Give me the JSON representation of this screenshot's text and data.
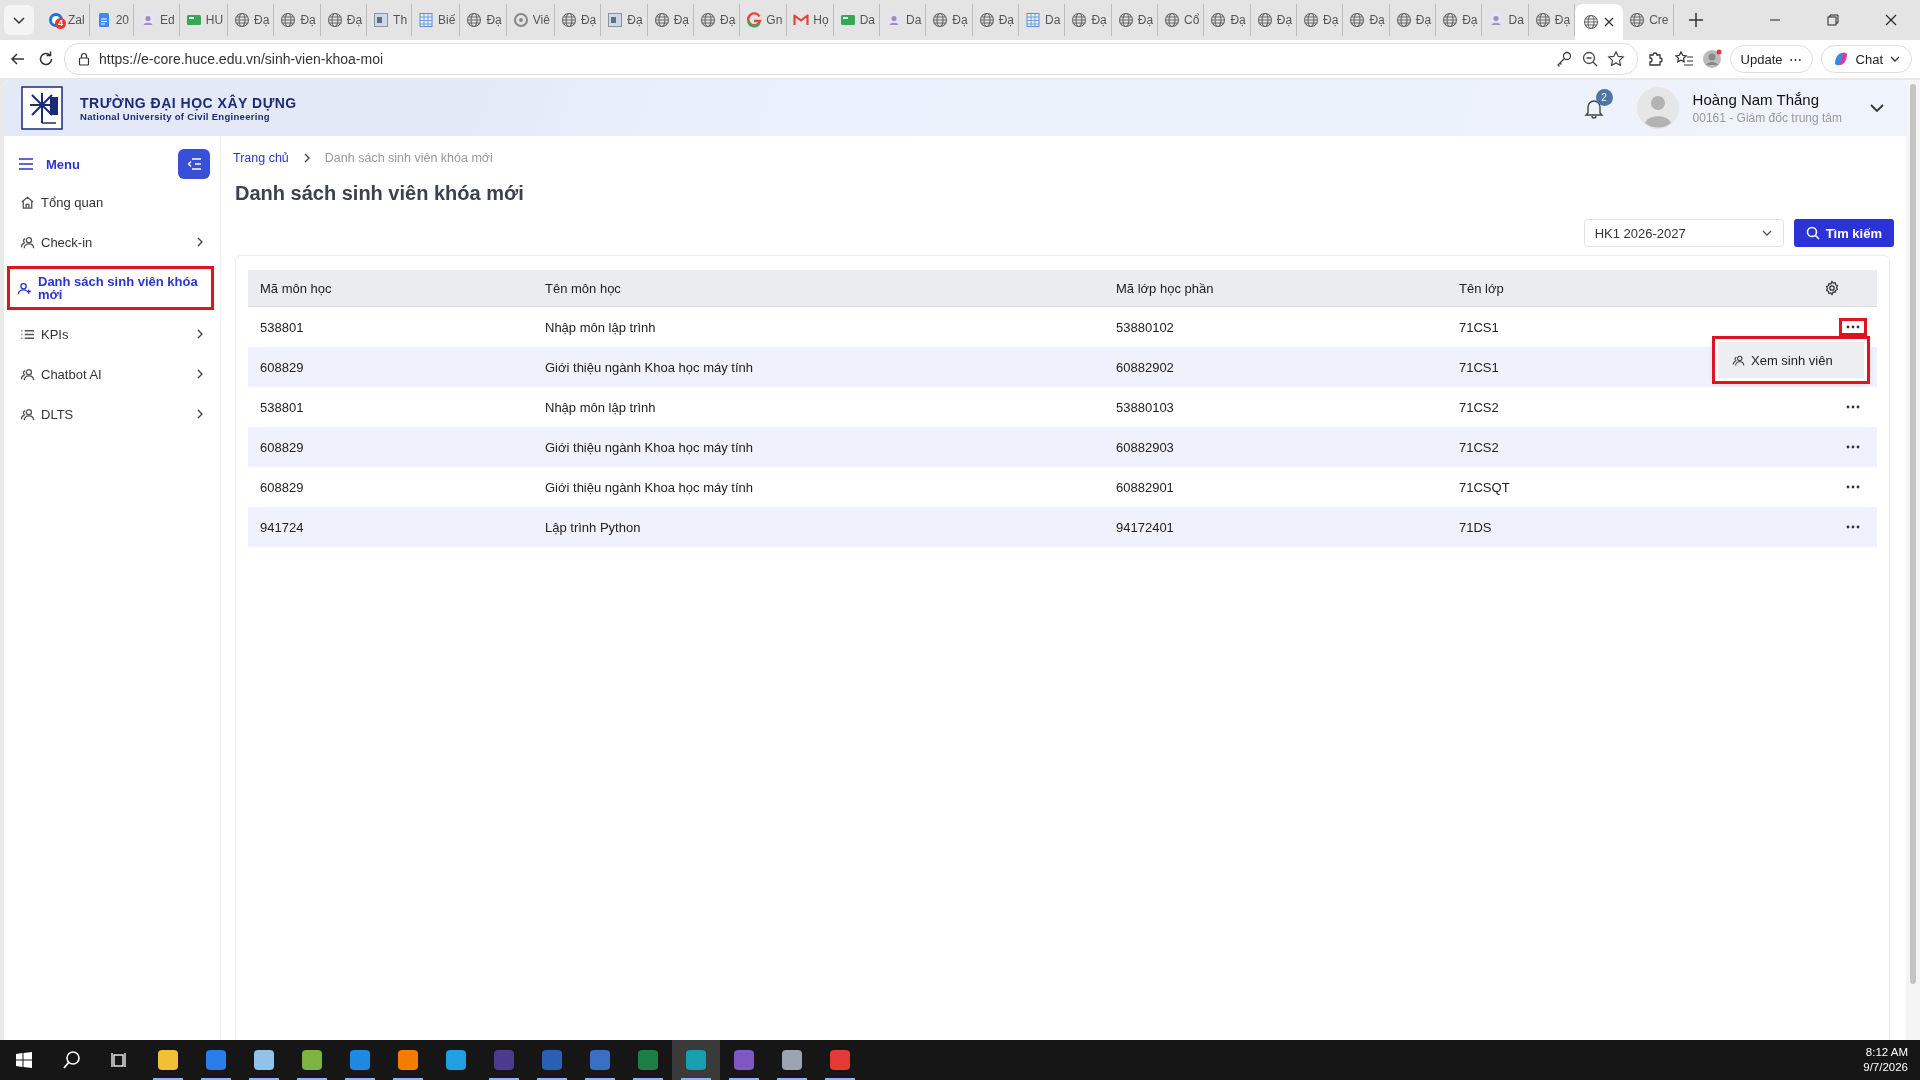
{
  "browser": {
    "tabs": [
      {
        "title": "Zal",
        "kind": "chat",
        "badge": "4",
        "selected": false
      },
      {
        "title": "20",
        "kind": "doc",
        "selected": false
      },
      {
        "title": "Ed",
        "kind": "person",
        "selected": false
      },
      {
        "title": "HU",
        "kind": "sheet",
        "selected": false
      },
      {
        "title": "Đạ",
        "kind": "globe",
        "selected": false
      },
      {
        "title": "Đạ",
        "kind": "globe",
        "selected": false
      },
      {
        "title": "Đạ",
        "kind": "globe",
        "selected": false
      },
      {
        "title": "Th",
        "kind": "image",
        "selected": false
      },
      {
        "title": "Biế",
        "kind": "grid",
        "selected": false
      },
      {
        "title": "Đạ",
        "kind": "globe",
        "selected": false
      },
      {
        "title": "Viê",
        "kind": "ring",
        "selected": false
      },
      {
        "title": "Đạ",
        "kind": "globe",
        "selected": false
      },
      {
        "title": "Đạ",
        "kind": "image",
        "selected": false
      },
      {
        "title": "Đạ",
        "kind": "globe",
        "selected": false
      },
      {
        "title": "Đạ",
        "kind": "globe",
        "selected": false
      },
      {
        "title": "Gn",
        "kind": "google",
        "selected": false
      },
      {
        "title": "Họ",
        "kind": "mail",
        "selected": false
      },
      {
        "title": "Da",
        "kind": "sheet",
        "selected": false
      },
      {
        "title": "Da",
        "kind": "person",
        "selected": false
      },
      {
        "title": "Đạ",
        "kind": "globe",
        "selected": false
      },
      {
        "title": "Đạ",
        "kind": "globe",
        "selected": false
      },
      {
        "title": "Da",
        "kind": "grid",
        "selected": false
      },
      {
        "title": "Đạ",
        "kind": "globe",
        "selected": false
      },
      {
        "title": "Đạ",
        "kind": "globe",
        "selected": false
      },
      {
        "title": "Cổ",
        "kind": "globe",
        "selected": false
      },
      {
        "title": "Đạ",
        "kind": "globe",
        "selected": false
      },
      {
        "title": "Đạ",
        "kind": "globe",
        "selected": false
      },
      {
        "title": "Đạ",
        "kind": "globe",
        "selected": false
      },
      {
        "title": "Đạ",
        "kind": "globe",
        "selected": false
      },
      {
        "title": "Đạ",
        "kind": "globe",
        "selected": false
      },
      {
        "title": "Đạ",
        "kind": "globe",
        "selected": false
      },
      {
        "title": "Da",
        "kind": "person",
        "selected": false
      },
      {
        "title": "Đạ",
        "kind": "globe",
        "selected": false
      },
      {
        "kind": "globe",
        "selected": true
      },
      {
        "title": "Cre",
        "kind": "globe",
        "selected": false
      }
    ],
    "url": "https://e-core.huce.edu.vn/sinh-vien-khoa-moi",
    "update_button": "Update",
    "update_more": "⋯",
    "chat_button": "Chat"
  },
  "header": {
    "school_name": "TRƯỜNG ĐẠI HỌC XÂY DỰNG",
    "school_subtitle": "National University of Civil Engineering",
    "notification_count": "2",
    "user_name": "Hoàng Nam Thắng",
    "user_role": "00161 - Giám đốc trung tâm"
  },
  "sidebar": {
    "title": "Menu",
    "items": [
      {
        "label": "Tổng quan",
        "kind": "home",
        "has_children": false,
        "selected": false,
        "highlighted": false
      },
      {
        "label": "Check-in",
        "kind": "users",
        "has_children": true,
        "selected": false,
        "highlighted": false
      },
      {
        "label": "Danh sách sinh viên khóa mới",
        "kind": "user-add",
        "has_children": false,
        "selected": true,
        "highlighted": true
      },
      {
        "label": "KPIs",
        "kind": "list",
        "has_children": true,
        "selected": false,
        "highlighted": false
      },
      {
        "label": "Chatbot AI",
        "kind": "users",
        "has_children": true,
        "selected": false,
        "highlighted": false
      },
      {
        "label": "DLTS",
        "kind": "users",
        "has_children": true,
        "selected": false,
        "highlighted": false
      }
    ]
  },
  "breadcrumb": [
    "Trang chủ",
    "Danh sách sinh viên khóa mới"
  ],
  "page_title": "Danh sách sinh viên khóa mới",
  "semester_select": {
    "value": "HK1 2026-2027"
  },
  "search_button": "Tìm kiếm",
  "table": {
    "columns": [
      "Mã môn học",
      "Tên môn học",
      "Mã lớp học phần",
      "Tên lớp"
    ],
    "rows": [
      {
        "cells": [
          "538801",
          "Nhập môn lập trình",
          "53880102",
          "71CS1"
        ],
        "menu_open": true
      },
      {
        "cells": [
          "608829",
          "Giới thiệu ngành Khoa học máy tính",
          "60882902",
          "71CS1"
        ],
        "menu_open": false
      },
      {
        "cells": [
          "538801",
          "Nhập môn lập trình",
          "53880103",
          "71CS2"
        ],
        "menu_open": false
      },
      {
        "cells": [
          "608829",
          "Giới thiệu ngành Khoa học máy tính",
          "60882903",
          "71CS2"
        ],
        "menu_open": false
      },
      {
        "cells": [
          "608829",
          "Giới thiệu ngành Khoa học máy tính",
          "60882901",
          "71CSQT"
        ],
        "menu_open": false
      },
      {
        "cells": [
          "941724",
          "Lập trình Python",
          "94172401",
          "71DS"
        ],
        "menu_open": false
      }
    ],
    "row_menu": {
      "items": [
        "Xem sinh viên"
      ],
      "highlighted": true
    }
  },
  "taskbar": {
    "apps": [
      {
        "color": "#f2c037",
        "running": true,
        "selected": false
      },
      {
        "color": "#2b7de9",
        "running": true,
        "selected": false
      },
      {
        "color": "#8fc3e8",
        "running": true,
        "selected": false
      },
      {
        "color": "#7cb342",
        "running": true,
        "selected": false
      },
      {
        "color": "#1e88e5",
        "running": true,
        "selected": false
      },
      {
        "color": "#f57c00",
        "running": true,
        "selected": false
      },
      {
        "color": "#20a0e0",
        "running": false,
        "selected": false
      },
      {
        "color": "#4a3b8c",
        "running": true,
        "selected": false
      },
      {
        "color": "#2b5fb4",
        "running": true,
        "selected": false
      },
      {
        "color": "#3a6fc4",
        "running": true,
        "selected": false
      },
      {
        "color": "#1e7e45",
        "running": true,
        "selected": false
      },
      {
        "color": "#18a0b0",
        "running": true,
        "selected": true
      },
      {
        "color": "#7e57c2",
        "running": true,
        "selected": false
      },
      {
        "color": "#9aa4b0",
        "running": true,
        "selected": false
      },
      {
        "color": "#e53935",
        "running": true,
        "selected": false
      }
    ],
    "time": "8:12 AM",
    "date": "9/7/2026"
  }
}
